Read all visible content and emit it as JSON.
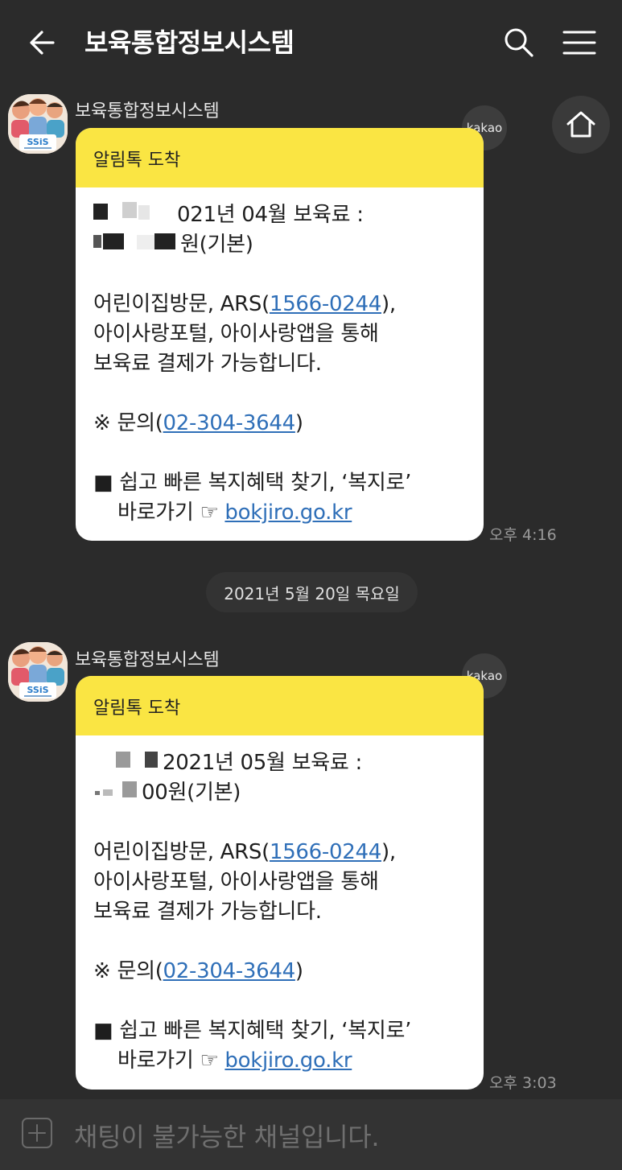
{
  "header": {
    "title": "보육통합정보시스템",
    "back_icon": "arrow-left-icon",
    "search_icon": "search-icon",
    "menu_icon": "hamburger-menu-icon"
  },
  "home_icon": "home-icon",
  "messages": [
    {
      "sender": "보육통합정보시스템",
      "badge": "kakao",
      "head": "알림톡 도착",
      "line1_text": "021년 04월 보육료 :",
      "line2_text": "원(기본)",
      "pay_prefix": "어린이집방문, ARS(",
      "ars_number": "1566-0244",
      "pay_suffix": "),",
      "pay_line2": "아이사랑포털, 아이사랑앱을 통해",
      "pay_line3": "보육료 결제가 가능합니다.",
      "inq_prefix": "※ 문의(",
      "inq_number": "02-304-3644",
      "inq_suffix": ")",
      "promo_line1": "■ 쉽고 빠른 복지혜택 찾기, ‘복지로’",
      "promo_line2_prefix": "바로가기 ☞ ",
      "promo_link": "bokjiro.go.kr",
      "time": "오후 4:16"
    },
    {
      "sender": "보육통합정보시스템",
      "badge": "kakao",
      "head": "알림톡 도착",
      "line1_text": "2021년 05월 보육료 :",
      "line2_text": "00원(기본)",
      "pay_prefix": "어린이집방문, ARS(",
      "ars_number": "1566-0244",
      "pay_suffix": "),",
      "pay_line2": "아이사랑포털, 아이사랑앱을 통해",
      "pay_line3": "보육료 결제가 가능합니다.",
      "inq_prefix": "※ 문의(",
      "inq_number": "02-304-3644",
      "inq_suffix": ")",
      "promo_line1": "■ 쉽고 빠른 복지혜택 찾기, ‘복지로’",
      "promo_line2_prefix": "바로가기 ☞ ",
      "promo_link": "bokjiro.go.kr",
      "time": "오후 3:03"
    }
  ],
  "date_divider": "2021년 5월 20일 목요일",
  "bottom_bar": {
    "plus_icon": "plus-square-icon",
    "status_text": "채팅이 불가능한 채널입니다."
  },
  "colors": {
    "background": "#2b2b2b",
    "card_header": "#fae543",
    "link": "#2f6fb8"
  }
}
